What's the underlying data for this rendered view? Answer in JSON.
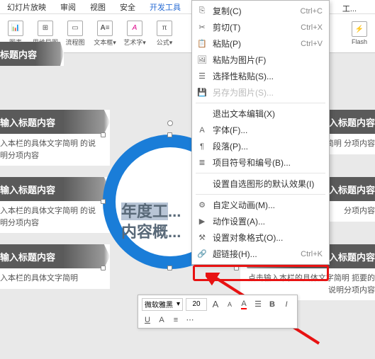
{
  "menu": {
    "items": [
      "幻灯片放映",
      "审阅",
      "视图",
      "安全",
      "开发工具"
    ],
    "active": 4,
    "search": "工..."
  },
  "toolbar": {
    "chart": "图表",
    "mind": "思维导图",
    "flow": "流程图",
    "text": "文本框",
    "art": "艺术字",
    "formula": "公式",
    "flash": "Flash",
    "drop": "▾"
  },
  "slide": {
    "titleHeader": "标题内容",
    "boxes": [
      {
        "h": "输入标题内容",
        "t": "入本栏的具体文字简明\n的说明分项内容"
      },
      {
        "h": "输入标题内容",
        "t": "入本栏的具体文字简明\n的说明分项内容"
      },
      {
        "h": "输入标题内容",
        "t": "入本栏的具体文字简明\n"
      }
    ],
    "rboxes": [
      {
        "h": "入标题内容",
        "t": "体文字简明\n分项内容"
      },
      {
        "h": "点击输入标题内容",
        "t": "分项内容"
      },
      {
        "h": "点击输入标题内容",
        "t": "点击输入本栏的具体文字简明\n扼要的说明分项内容"
      }
    ],
    "center": {
      "l1": "年度工",
      "l2": "内容概"
    }
  },
  "ctx": {
    "copy": "复制(C)",
    "cut": "剪切(T)",
    "paste": "粘贴(P)",
    "pasteimg": "粘贴为图片(F)",
    "pastesp": "选择性粘贴(S)...",
    "saveas": "另存为图片(S)...",
    "exittxt": "退出文本编辑(X)",
    "font": "字体(F)...",
    "para": "段落(P)...",
    "bullets": "项目符号和编号(B)...",
    "shapedef": "设置自选图形的默认效果(I)",
    "anim": "自定义动画(M)...",
    "actset": "动作设置(A)...",
    "objfmt": "设置对象格式(O)...",
    "hyperlink": "超链接(H)...",
    "sc": {
      "copy": "Ctrl+C",
      "cut": "Ctrl+X",
      "paste": "Ctrl+V",
      "hyper": "Ctrl+K"
    }
  },
  "float": {
    "font": "微软雅黑",
    "size": "20",
    "b": "B",
    "i": "I",
    "u": "U",
    "aplus": "A",
    "aminus": "A",
    "color": "A"
  }
}
